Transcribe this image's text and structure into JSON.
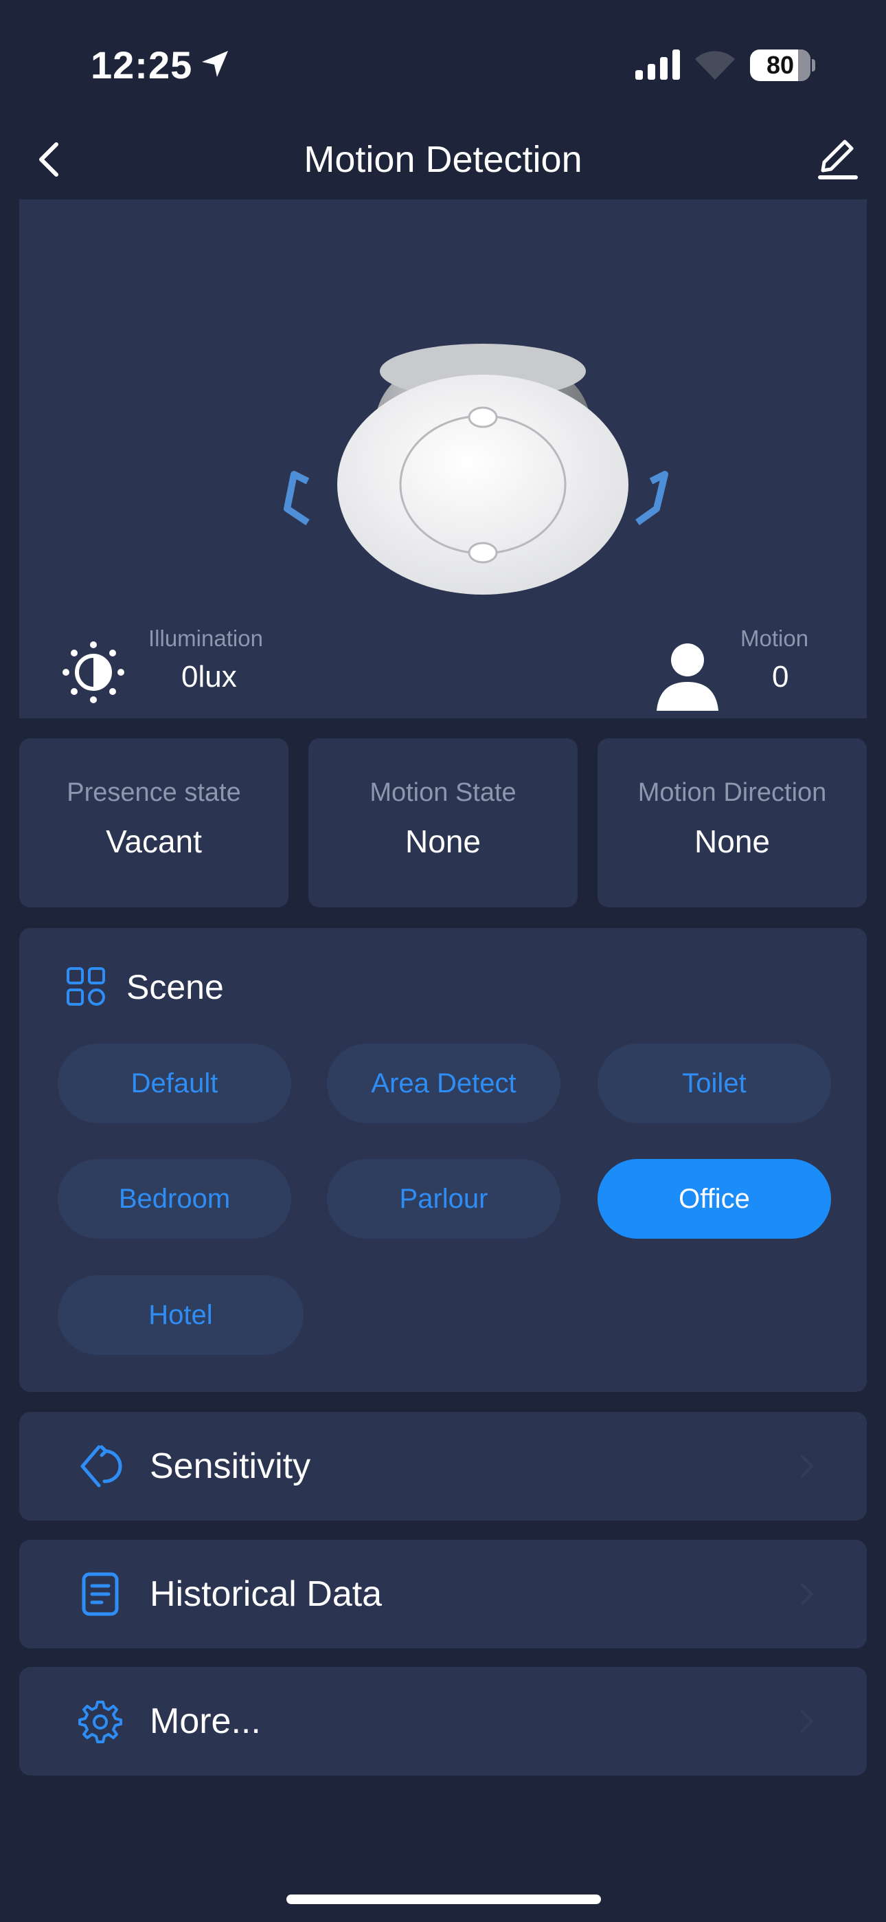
{
  "status_bar": {
    "time": "12:25",
    "battery": "80"
  },
  "header": {
    "title": "Motion Detection"
  },
  "device": {
    "illumination_label": "Illumination",
    "illumination_value": "0lux",
    "motion_label": "Motion",
    "motion_value": "0"
  },
  "states": [
    {
      "label": "Presence state",
      "value": "Vacant"
    },
    {
      "label": "Motion State",
      "value": "None"
    },
    {
      "label": "Motion Direction",
      "value": "None"
    }
  ],
  "scene": {
    "title": "Scene",
    "options": [
      "Default",
      "Area Detect",
      "Toilet",
      "Bedroom",
      "Parlour",
      "Office",
      "Hotel"
    ],
    "selected": "Office"
  },
  "menu": [
    {
      "label": "Sensitivity",
      "icon": "sensitivity-icon"
    },
    {
      "label": "Historical Data",
      "icon": "document-icon"
    },
    {
      "label": "More...",
      "icon": "gear-icon"
    }
  ],
  "colors": {
    "background": "#1e2439",
    "card": "#2b3450",
    "accent": "#1b8cf8",
    "chip": "#2f3d5e",
    "muted_text": "#8e97ad"
  }
}
